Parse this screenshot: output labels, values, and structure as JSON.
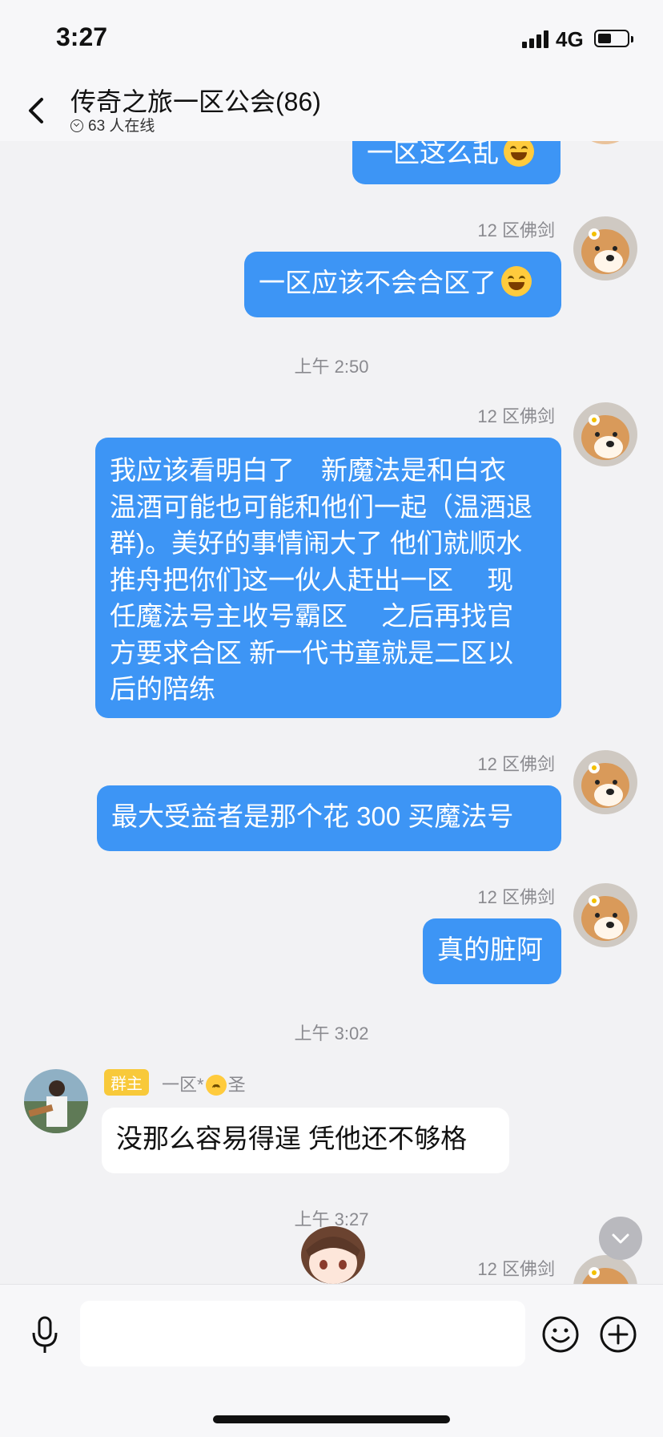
{
  "status_bar": {
    "time": "3:27",
    "network": "4G"
  },
  "header": {
    "title": "传奇之旅一区公会(86)",
    "online": "63 人在线"
  },
  "messages": [
    {
      "id": "m0",
      "sender": "",
      "text": "一区这么乱"
    },
    {
      "id": "m1",
      "sender": "12 区佛剑",
      "text": "一区应该不会合区了"
    },
    {
      "id": "m2",
      "sender": "12 区佛剑",
      "lines": [
        "我应该看明白了　新魔法是和白衣",
        "温酒可能也可能和他们一起（温酒退",
        "群)。美好的事情闹大了  他们就顺水",
        "推舟把你们这一伙人赶出一区　 现",
        "任魔法号主收号霸区　  之后再找官",
        "方要求合区  新一代书童就是二区以",
        "后的陪练"
      ]
    },
    {
      "id": "m3",
      "sender": "12 区佛剑",
      "text": "最大受益者是那个花 300 买魔法号"
    },
    {
      "id": "m4",
      "sender": "12 区佛剑",
      "text": "真的脏阿"
    },
    {
      "id": "m5",
      "badge": "群主",
      "sender_prefix": "一区*",
      "sender_suffix": "圣",
      "text": "没那么容易得逞   凭他还不够格"
    },
    {
      "id": "m6",
      "sender": "12 区佛剑",
      "text": ""
    }
  ],
  "timestamps": [
    "上午 2:50",
    "上午 3:02",
    "上午 3:27"
  ],
  "icons": {
    "back": "chevron-left-icon",
    "online": "chevron-down-circle-icon",
    "voice": "microphone-icon",
    "emoji": "smiley-icon",
    "plus": "plus-circle-icon",
    "scroll": "chevron-down-icon"
  },
  "colors": {
    "outgoing_bubble": "#3d95f5",
    "incoming_bubble": "#ffffff",
    "owner_badge": "#f8c93a"
  }
}
